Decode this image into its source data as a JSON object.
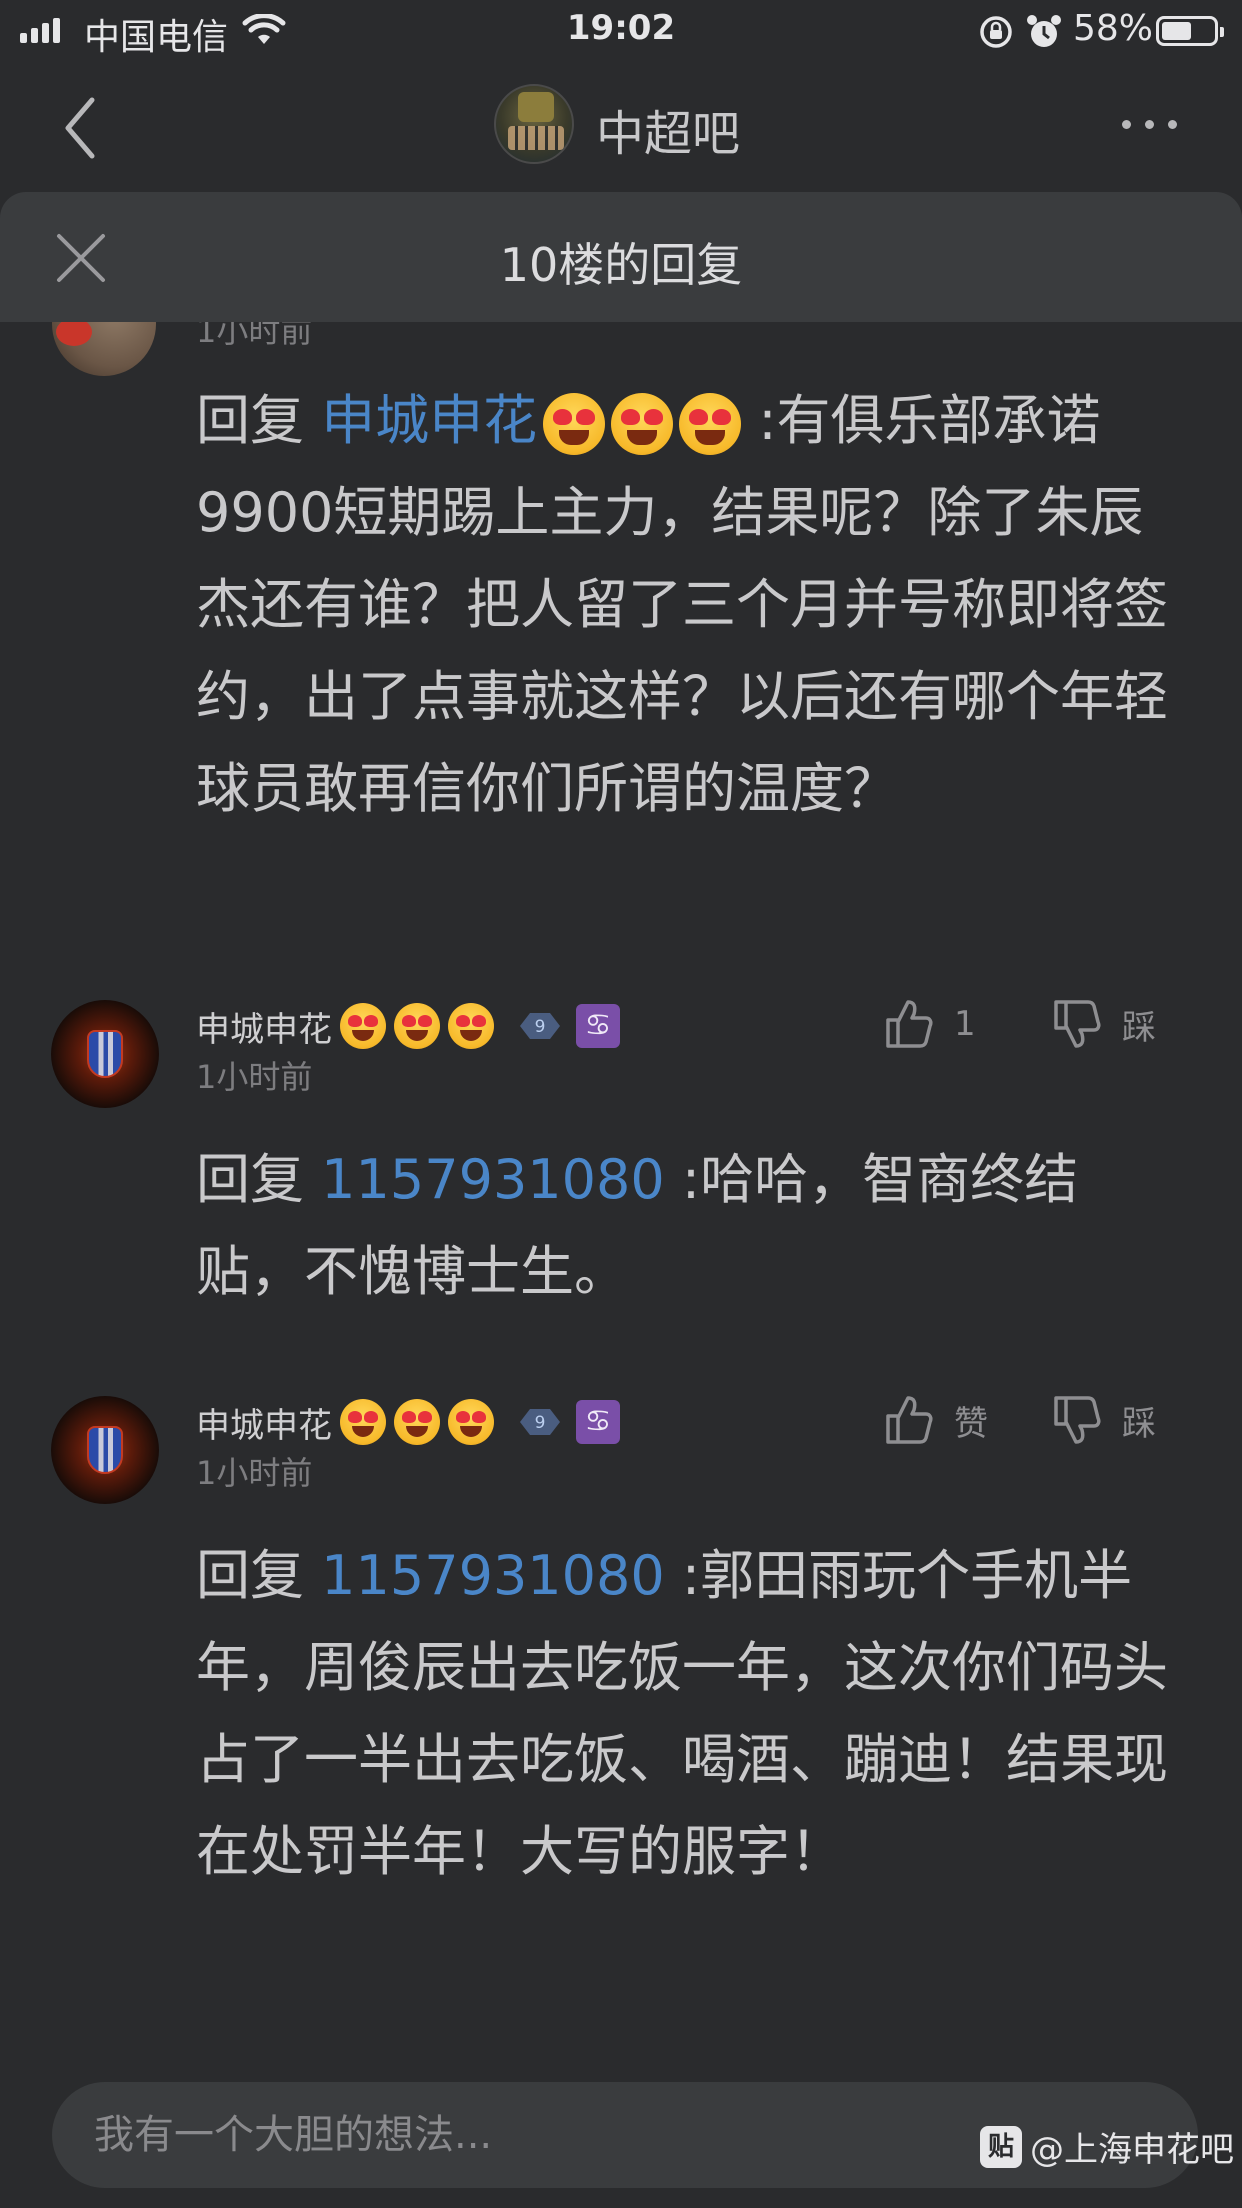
{
  "status_bar": {
    "carrier": "中国电信",
    "time": "19:02",
    "battery_percent": "58%",
    "battery_level": 0.58
  },
  "nav": {
    "title": "中超吧"
  },
  "sheet": {
    "title": "10楼的回复"
  },
  "partial_top": {
    "time": "1小时前"
  },
  "comments": [
    {
      "reply_prefix": "回复 ",
      "mention": "申城申花",
      "text_line1": " :有俱乐部承",
      "text_rest": "诺9900短期踢上主力，结果呢？除了朱辰杰还有谁？把人留了三个月并号称即将签约，出了点事就这样？以后还有哪个年轻球员敢再信你们所谓的温度？"
    },
    {
      "username": "申城申花",
      "level": "9",
      "zodiac": "♋",
      "time": "1小时前",
      "like_label": "1",
      "dislike_label": "踩",
      "reply_prefix": "回复 ",
      "mention": "1157931080",
      "text": " :哈哈，智商终结贴，不愧博士生。"
    },
    {
      "username": "申城申花",
      "level": "9",
      "zodiac": "♋",
      "time": "1小时前",
      "like_label": "赞",
      "dislike_label": "踩",
      "reply_prefix": "回复 ",
      "mention": "1157931080",
      "text": " :郭田雨玩个手机半年，周俊辰出去吃饭一年，这次你们码头占了一半出去吃饭、喝酒、蹦迪！结果现在处罚半年！大写的服字！"
    }
  ],
  "input": {
    "placeholder": "我有一个大胆的想法..."
  },
  "watermark": {
    "logo": "贴",
    "text": "@上海申花吧"
  }
}
